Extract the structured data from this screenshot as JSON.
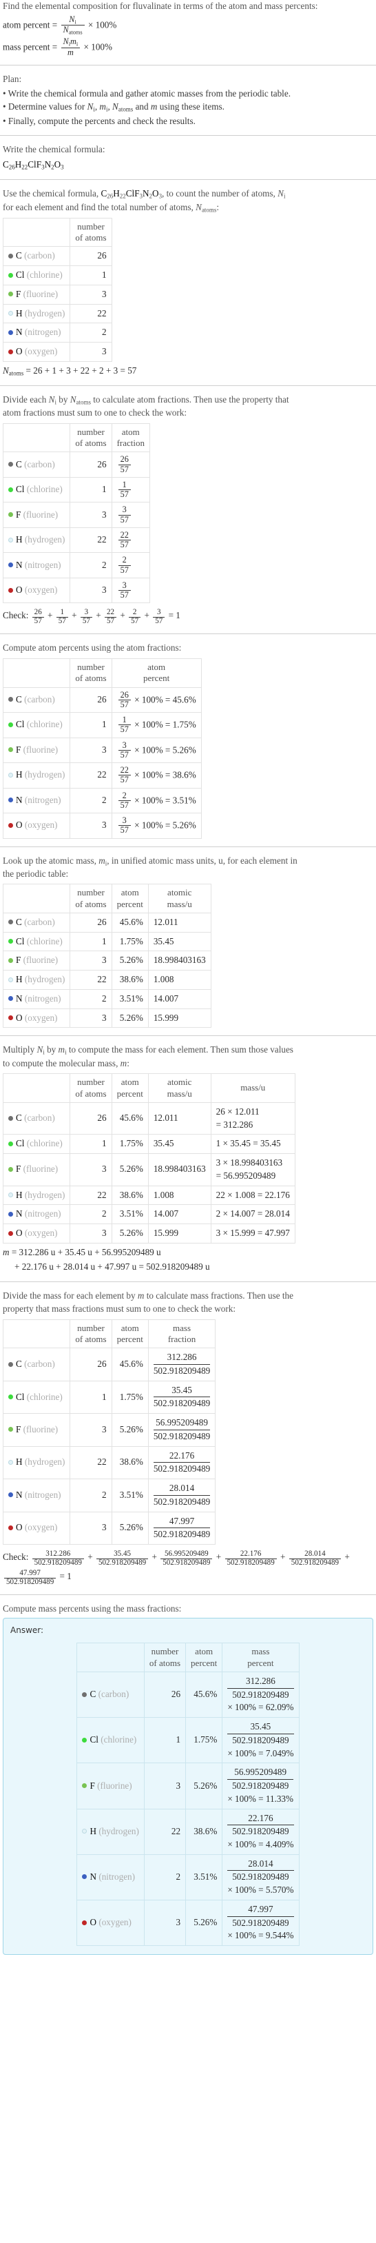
{
  "header": {
    "question": "Find the elemental composition for fluvalinate in terms of the atom and mass percents:",
    "atom_percent_label": "atom percent =",
    "atom_percent_num": "N",
    "atom_percent_num_sub": "i",
    "atom_percent_den": "N",
    "atom_percent_den_sub": "atoms",
    "times_100": "× 100%",
    "mass_percent_label": "mass percent =",
    "mass_percent_num": "N",
    "mass_percent_num_sub": "i",
    "mass_percent_num2": "m",
    "mass_percent_num2_sub": "i",
    "mass_percent_den": "m"
  },
  "plan": {
    "title": "Plan:",
    "items": [
      "• Write the chemical formula and gather atomic masses from the periodic table.",
      "• Determine values for Ni, mi, Natoms and m using these items.",
      "• Finally, compute the percents and check the results."
    ],
    "bullet2_parts": {
      "pre": "• Determine values for ",
      "n": "N",
      "n_sub": "i",
      "sep1": ", ",
      "m": "m",
      "m_sub": "i",
      "sep2": ", ",
      "natoms": "N",
      "natoms_sub": "atoms",
      "mid": " and ",
      "mm": "m",
      "post": " using these items."
    }
  },
  "formula_section": {
    "intro": "Write the chemical formula:",
    "formula_parts": [
      {
        "sym": "C",
        "sub": "26"
      },
      {
        "sym": "H",
        "sub": "22"
      },
      {
        "sym": "Cl",
        "sub": ""
      },
      {
        "sym": "F",
        "sub": "3"
      },
      {
        "sym": "N",
        "sub": "2"
      },
      {
        "sym": "O",
        "sub": "3"
      }
    ]
  },
  "atoms_section": {
    "intro_pre": "Use the chemical formula, ",
    "intro_post": ", to count the number of atoms, ",
    "intro_n": "N",
    "intro_n_sub": "i",
    "intro_line2": "for each element and find the total number of atoms, ",
    "intro_natoms": "N",
    "intro_natoms_sub": "atoms",
    "intro_colon": ":",
    "col_header": "number\nof atoms",
    "col_header_l1": "number",
    "col_header_l2": "of atoms",
    "total_label": "N",
    "total_label_sub": "atoms",
    "total_expr": "= 26 + 1 + 3 + 22 + 2 + 3 = 57"
  },
  "elements": [
    {
      "symbol": "C",
      "name": "(carbon)",
      "color": "#6f6f6f",
      "hollow": false,
      "count": "26",
      "atom_fraction_num": "26",
      "atom_fraction_den": "57",
      "atom_percent": "45.6%",
      "atomic_mass": "12.011",
      "mass_expr_line1": "26 × 12.011",
      "mass_expr_line2": "= 312.286",
      "mass_expr_inline": "",
      "mass": "312.286",
      "mass_percent": "62.09%"
    },
    {
      "symbol": "Cl",
      "name": "(chlorine)",
      "color": "#3ddb3d",
      "hollow": false,
      "count": "1",
      "atom_fraction_num": "1",
      "atom_fraction_den": "57",
      "atom_percent": "1.75%",
      "atomic_mass": "35.45",
      "mass_expr_line1": "",
      "mass_expr_line2": "",
      "mass_expr_inline": "1 × 35.45 = 35.45",
      "mass": "35.45",
      "mass_percent": "7.049%"
    },
    {
      "symbol": "F",
      "name": "(fluorine)",
      "color": "#78c353",
      "hollow": false,
      "count": "3",
      "atom_fraction_num": "3",
      "atom_fraction_den": "57",
      "atom_percent": "5.26%",
      "atomic_mass": "18.998403163",
      "mass_expr_line1": "3 × 18.998403163",
      "mass_expr_line2": "= 56.995209489",
      "mass_expr_inline": "",
      "mass": "56.995209489",
      "mass_percent": "11.33%"
    },
    {
      "symbol": "H",
      "name": "(hydrogen)",
      "color": "#e2f2f7",
      "hollow": true,
      "count": "22",
      "atom_fraction_num": "22",
      "atom_fraction_den": "57",
      "atom_percent": "38.6%",
      "atomic_mass": "1.008",
      "mass_expr_line1": "",
      "mass_expr_line2": "",
      "mass_expr_inline": "22 × 1.008 = 22.176",
      "mass": "22.176",
      "mass_percent": "4.409%"
    },
    {
      "symbol": "N",
      "name": "(nitrogen)",
      "color": "#3b5fc0",
      "hollow": false,
      "count": "2",
      "atom_fraction_num": "2",
      "atom_fraction_den": "57",
      "atom_percent": "3.51%",
      "atomic_mass": "14.007",
      "mass_expr_line1": "",
      "mass_expr_line2": "",
      "mass_expr_inline": "2 × 14.007 = 28.014",
      "mass": "28.014",
      "mass_percent": "5.570%"
    },
    {
      "symbol": "O",
      "name": "(oxygen)",
      "color": "#c02626",
      "hollow": false,
      "count": "3",
      "atom_fraction_num": "3",
      "atom_fraction_den": "57",
      "atom_percent": "5.26%",
      "atomic_mass": "15.999",
      "mass_expr_line1": "",
      "mass_expr_line2": "",
      "mass_expr_inline": "3 × 15.999 = 47.997",
      "mass": "47.997",
      "mass_percent": "9.544%"
    }
  ],
  "atom_fraction_section": {
    "intro_l1_pre": "Divide each ",
    "intro_n": "N",
    "intro_n_sub": "i",
    "intro_l1_mid": " by ",
    "intro_natoms": "N",
    "intro_natoms_sub": "atoms",
    "intro_l1_post": " to calculate atom fractions. Then use the property that",
    "intro_l2": "atom fractions must sum to one to check the work:",
    "col1_l1": "number",
    "col1_l2": "of atoms",
    "col2_l1": "atom",
    "col2_l2": "fraction",
    "check_label": "Check:",
    "check_result": "= 1"
  },
  "atom_percent_section": {
    "intro": "Compute atom percents using the atom fractions:",
    "col1_l1": "number",
    "col1_l2": "of atoms",
    "col2_l1": "atom",
    "col2_l2": "percent",
    "times100_eq": "× 100% ="
  },
  "atomic_mass_section": {
    "intro_l1_pre": "Look up the atomic mass, ",
    "intro_m": "m",
    "intro_m_sub": "i",
    "intro_l1_post": ", in unified atomic mass units, u, for each element in",
    "intro_l2": "the periodic table:",
    "col1_l1": "number",
    "col1_l2": "of atoms",
    "col2_l1": "atom",
    "col2_l2": "percent",
    "col3_l1": "atomic",
    "col3_l2": "mass/u"
  },
  "mass_section": {
    "intro_l1_pre": "Multiply ",
    "intro_n": "N",
    "intro_n_sub": "i",
    "intro_l1_mid": " by ",
    "intro_m": "m",
    "intro_m_sub": "i",
    "intro_l1_post": " to compute the mass for each element. Then sum those values",
    "intro_l2_pre": "to compute the molecular mass, ",
    "intro_l2_m": "m",
    "intro_l2_post": ":",
    "col1_l1": "number",
    "col1_l2": "of atoms",
    "col2_l1": "atom",
    "col2_l2": "percent",
    "col3_l1": "atomic",
    "col3_l2": "mass/u",
    "col4": "mass/u",
    "total_m": "m",
    "total_line1": "= 312.286 u + 35.45 u + 56.995209489 u",
    "total_line2": "+ 22.176 u + 28.014 u + 47.997 u = 502.918209489 u"
  },
  "mass_fraction_section": {
    "intro_l1_pre": "Divide the mass for each element by ",
    "intro_m": "m",
    "intro_l1_post": " to calculate mass fractions. Then use the",
    "intro_l2": "property that mass fractions must sum to one to check the work:",
    "col1_l1": "number",
    "col1_l2": "of atoms",
    "col2_l1": "atom",
    "col2_l2": "percent",
    "col3_l1": "mass",
    "col3_l2": "fraction",
    "total_mass": "502.918209489",
    "check_label": "Check:",
    "check_result": "= 1"
  },
  "mass_percent_section": {
    "intro": "Compute mass percents using the mass fractions:",
    "answer_label": "Answer:",
    "col1_l1": "number",
    "col1_l2": "of atoms",
    "col2_l1": "atom",
    "col2_l2": "percent",
    "col3_l1": "mass",
    "col3_l2": "percent",
    "total_mass": "502.918209489",
    "times100": "× 100% ="
  }
}
